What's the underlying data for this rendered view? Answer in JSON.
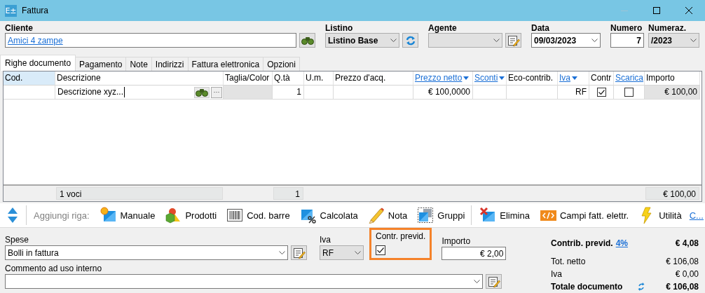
{
  "window": {
    "title": "Fattura",
    "logo": "E±"
  },
  "header": {
    "fields": [
      {
        "kind": "link",
        "label": "Cliente",
        "value": "Amici 4 zampe",
        "button": {
          "kind": "search"
        }
      },
      {
        "kind": "select",
        "label": "Listino",
        "value": "Listino Base",
        "button": {
          "kind": "refresh"
        }
      },
      {
        "kind": "select",
        "label": "Agente",
        "button": {
          "kind": "edit"
        }
      },
      {
        "kind": "date",
        "label": "Data",
        "value": "09/03/2023"
      },
      {
        "kind": "number",
        "label": "Numero",
        "value": "7"
      },
      {
        "kind": "select",
        "label": "Numeraz.",
        "value": "/2023"
      }
    ]
  },
  "tabs": [
    {
      "label": "Righe documento",
      "selected": true
    },
    {
      "label": "Pagamento",
      "selected": false
    },
    {
      "label": "Note",
      "selected": false
    },
    {
      "label": "Indirizzi",
      "selected": false
    },
    {
      "label": "Fattura elettronica",
      "selected": false
    },
    {
      "label": "Opzioni",
      "selected": false
    }
  ],
  "grid": {
    "columns": [
      {
        "label": "Cod.",
        "kind": "plain",
        "selected": true
      },
      {
        "label": "Descrizione",
        "kind": "plain",
        "selected": false
      },
      {
        "label": "Taglia/Color",
        "kind": "plain",
        "selected": false
      },
      {
        "label": "Q.tà",
        "kind": "plain",
        "selected": false
      },
      {
        "label": "U.m.",
        "kind": "plain",
        "selected": false
      },
      {
        "label": "Prezzo d'acq.",
        "kind": "plain",
        "selected": false
      },
      {
        "label": "Prezzo netto",
        "kind": "menu",
        "selected": false
      },
      {
        "label": "Sconti",
        "kind": "menu",
        "selected": false
      },
      {
        "label": "Eco-contrib.",
        "kind": "plain",
        "selected": false
      },
      {
        "label": "Iva",
        "kind": "menu",
        "selected": false
      },
      {
        "label": "Contr",
        "kind": "plain",
        "selected": false
      },
      {
        "label": "Scarica",
        "kind": "link",
        "selected": false
      },
      {
        "label": "Importo",
        "kind": "plain",
        "selected": false
      }
    ],
    "rows": [
      {
        "cells": [
          {
            "kind": "text",
            "readonly": false
          },
          {
            "kind": "edit",
            "text": "Descrizione xyz...",
            "more": "···"
          },
          {
            "kind": "text",
            "readonly": true
          },
          {
            "kind": "text",
            "text": "1",
            "readonly": false
          },
          {
            "kind": "text",
            "readonly": false
          },
          {
            "kind": "text",
            "readonly": false
          },
          {
            "kind": "text",
            "text": "€ 100,0000",
            "readonly": false
          },
          {
            "kind": "text",
            "readonly": false
          },
          {
            "kind": "text",
            "readonly": false
          },
          {
            "kind": "text",
            "text": "RF",
            "readonly": false
          },
          {
            "kind": "check",
            "checked": true
          },
          {
            "kind": "check",
            "checked": false
          },
          {
            "kind": "text",
            "text": "€ 100,00",
            "readonly": true
          }
        ]
      }
    ],
    "footer": [
      {
        "kind": "none"
      },
      {
        "kind": "total",
        "text": "1 voci"
      },
      {
        "kind": "none"
      },
      {
        "kind": "total",
        "text": "1"
      },
      {
        "kind": "none"
      },
      {
        "kind": "none"
      },
      {
        "kind": "none"
      },
      {
        "kind": "none"
      },
      {
        "kind": "none"
      },
      {
        "kind": "none"
      },
      {
        "kind": "none"
      },
      {
        "kind": "none"
      },
      {
        "kind": "total",
        "text": "€ 100,00"
      }
    ]
  },
  "toolbar": {
    "items": [
      {
        "kind": "updown"
      },
      {
        "kind": "separator"
      },
      {
        "kind": "label",
        "text": "Aggiungi riga:"
      },
      {
        "kind": "button",
        "text": "Manuale"
      },
      {
        "kind": "button",
        "text": "Prodotti"
      },
      {
        "kind": "button",
        "text": "Cod. barre"
      },
      {
        "kind": "button",
        "text": "Calcolata"
      },
      {
        "kind": "button",
        "text": "Nota"
      },
      {
        "kind": "button",
        "text": "Gruppi"
      },
      {
        "kind": "separator"
      },
      {
        "kind": "button",
        "text": "Elimina"
      },
      {
        "kind": "button",
        "text": "Campi fatt. elettr."
      },
      {
        "kind": "button",
        "text": "Utilità"
      },
      {
        "kind": "link",
        "text": "C..."
      }
    ]
  },
  "expenses": {
    "spese": {
      "label": "Spese",
      "value": "Bolli in fattura"
    },
    "iva": {
      "label": "Iva",
      "value": "RF"
    },
    "contr_previd": {
      "label": "Contr. previd.",
      "checked": true,
      "highlighted": true
    },
    "importo": {
      "label": "Importo",
      "value": "€ 2,00"
    },
    "commento": {
      "label": "Commento ad uso interno"
    }
  },
  "summary": [
    {
      "kind": "strong",
      "label": "Contrib. previd.",
      "link": "4%",
      "value": "€ 4,08"
    },
    {
      "kind": "plain",
      "label": "Tot. netto",
      "value": "€ 106,08"
    },
    {
      "kind": "plain",
      "label": "Iva",
      "value": "€ 0,00"
    },
    {
      "kind": "total",
      "label": "Totale documento",
      "value": "€ 106,08"
    }
  ]
}
